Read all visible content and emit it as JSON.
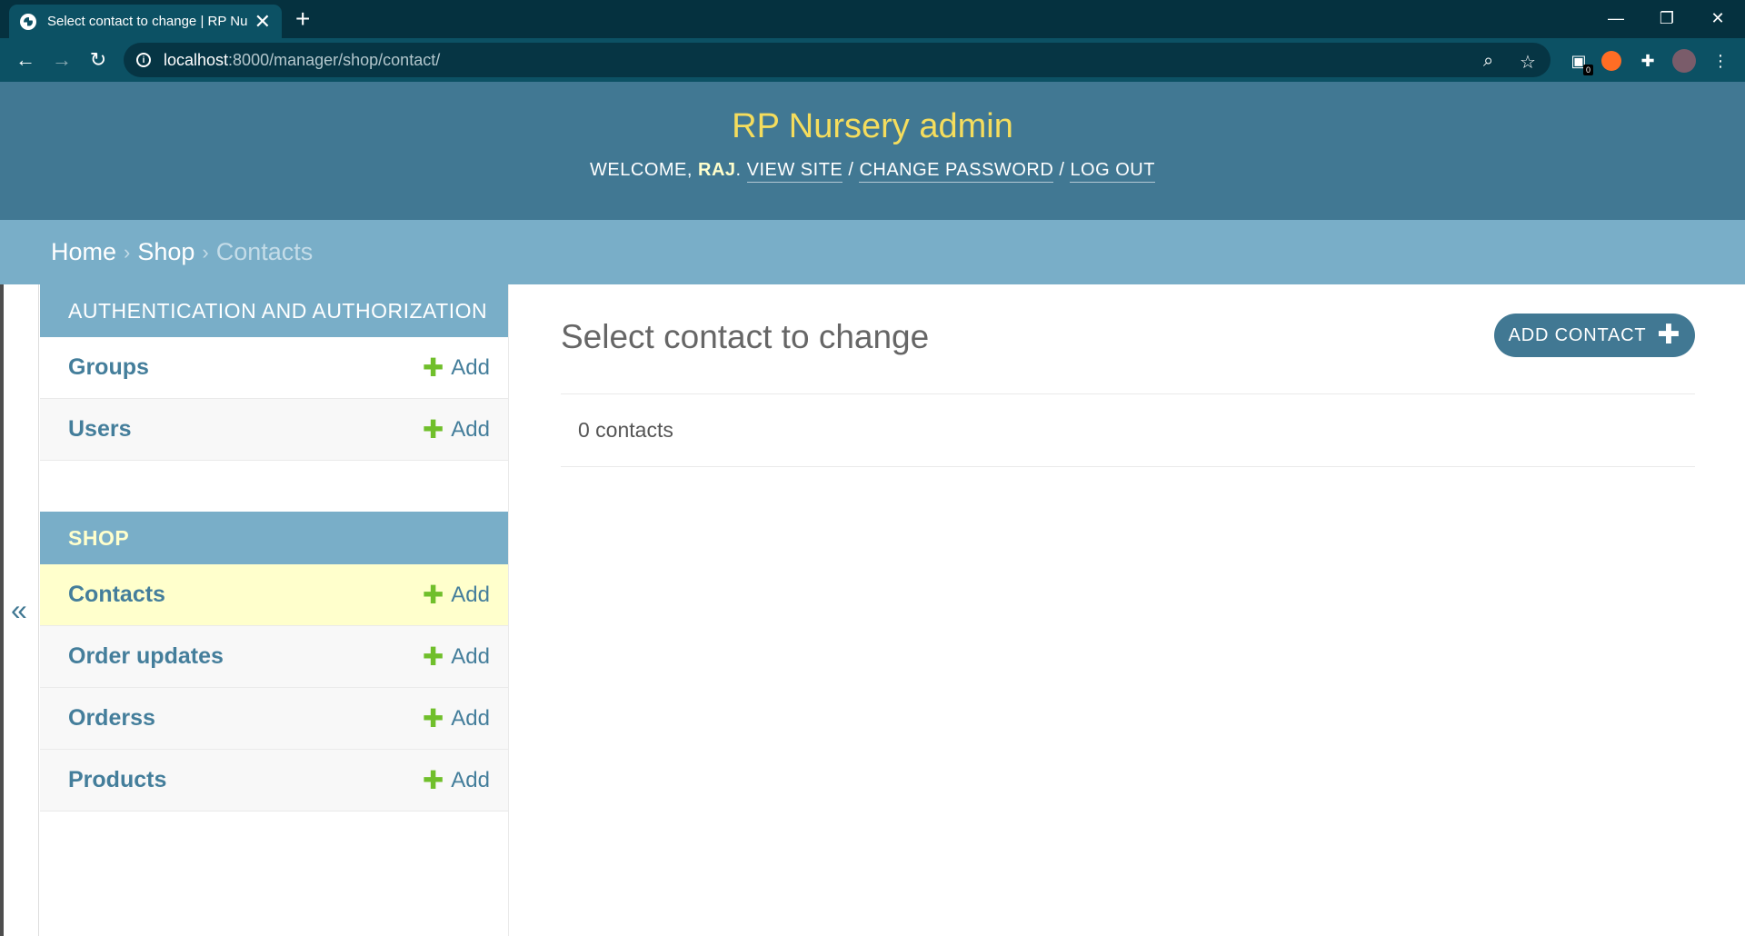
{
  "browser": {
    "tab_title": "Select contact to change | RP Nu",
    "tab_close": "✕",
    "new_tab": "+",
    "url_host": "localhost",
    "url_rest": ":8000/manager/shop/contact/",
    "extension_badge": "0",
    "window_controls": [
      "—",
      "❐",
      "✕"
    ]
  },
  "header": {
    "site_name": "RP Nursery admin",
    "welcome_prefix": "Welcome, ",
    "username": "Raj",
    "welcome_suffix": ". ",
    "view_site": "View site",
    "change_password": "Change password",
    "log_out": "Log out",
    "separator": " / "
  },
  "breadcrumbs": {
    "home": "Home",
    "shop": "Shop",
    "current": "Contacts",
    "sep": "›"
  },
  "sidebar": {
    "toggle": "«",
    "add_label": "Add",
    "modules": [
      {
        "caption": "Authentication and Authorization",
        "models": [
          {
            "name": "Groups"
          },
          {
            "name": "Users"
          }
        ]
      },
      {
        "caption": "Shop",
        "models": [
          {
            "name": "Contacts"
          },
          {
            "name": "Order updates"
          },
          {
            "name": "Orderss"
          },
          {
            "name": "Products"
          }
        ]
      }
    ]
  },
  "content": {
    "title": "Select contact to change",
    "add_button": "Add contact",
    "result_count": "0 contacts"
  },
  "colors": {
    "header_bg": "#417893",
    "breadcrumb_bg": "#79aec8",
    "site_name": "#f5dd5d",
    "link": "#447e9b",
    "add_green": "#70bf2b",
    "current_row": "#ffffcc"
  }
}
